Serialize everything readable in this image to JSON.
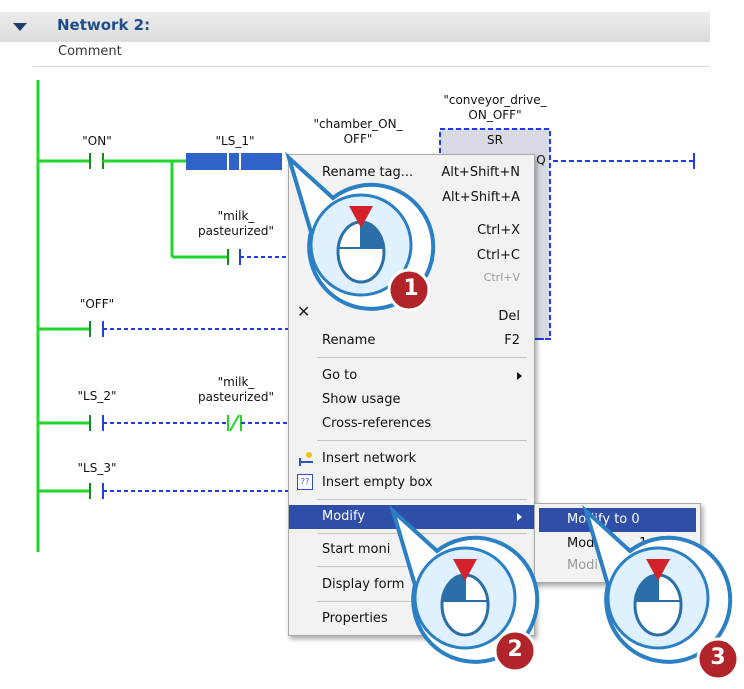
{
  "network": {
    "title": "Network 2:",
    "comment": "Comment"
  },
  "tags": {
    "on": "\"ON\"",
    "ls1": "\"LS_1\"",
    "milk1_a": "\"milk_",
    "milk1_b": "pasteurized\"",
    "chamber_a": "\"chamber_ON_",
    "chamber_b": "OFF\"",
    "conv_a": "\"conveyor_drive_",
    "conv_b": "ON_OFF\"",
    "sr": "SR",
    "q": "Q",
    "off": "\"OFF\"",
    "ls2": "\"LS_2\"",
    "milk2_a": "\"milk_",
    "milk2_b": "pasteurized\"",
    "ls3": "\"LS_3\""
  },
  "context_menu": {
    "rename_tag": "Rename tag...",
    "rename_tag_sc": "Alt+Shift+N",
    "item2_sc": "Alt+Shift+A",
    "cut_sc": "Ctrl+X",
    "copy_sc": "Ctrl+C",
    "paste_sc": "Ctrl+V",
    "delete_sc": "Del",
    "rename": "Rename",
    "rename_sc": "F2",
    "goto": "Go to",
    "show_usage": "Show usage",
    "cross_refs": "Cross-references",
    "insert_network": "Insert network",
    "insert_empty_box": "Insert empty box",
    "modify": "Modify",
    "start_monitoring": "Start moni",
    "display_format": "Display form",
    "properties": "Properties"
  },
  "submenu": {
    "modify_to_0": "Modify to 0",
    "modify_to_1_a": "Mod",
    "modify_to_1_b": "1",
    "modify_3": "Modi"
  },
  "callouts": {
    "one": "1",
    "two": "2",
    "three": "3"
  },
  "colors": {
    "power_rail": "#22d62c",
    "selection": "#2f63c8",
    "wire_dashed": "#1f3cf0",
    "menu_highlight": "#2f4ea8",
    "callout_badge": "#b0242a",
    "mouse_fill": "#dff0ff"
  }
}
